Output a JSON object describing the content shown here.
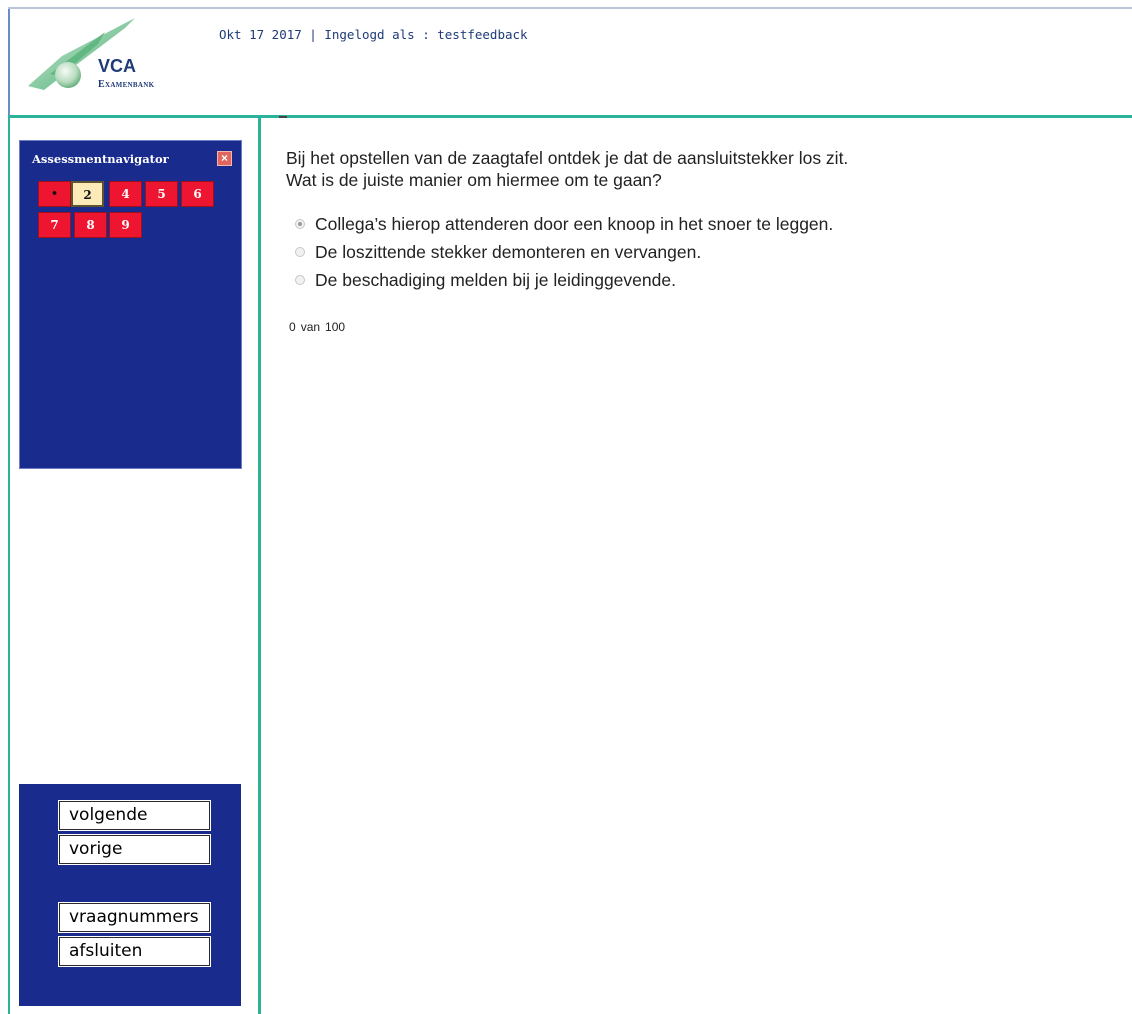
{
  "header": {
    "logo": {
      "line1": "VCA",
      "line2": "Examenbank"
    },
    "info": "Okt 17 2017 | Ingelogd als : testfeedback"
  },
  "navigator": {
    "title": "Assessmentnavigator",
    "close_icon": "close-icon",
    "questions": [
      {
        "label": "•",
        "state": "answered"
      },
      {
        "label": "2",
        "state": "current"
      },
      {
        "label": "4",
        "state": "unanswered"
      },
      {
        "label": "5",
        "state": "unanswered"
      },
      {
        "label": "6",
        "state": "unanswered"
      },
      {
        "label": "7",
        "state": "unanswered"
      },
      {
        "label": "8",
        "state": "unanswered"
      },
      {
        "label": "9",
        "state": "unanswered"
      }
    ]
  },
  "buttons": {
    "next": "volgende",
    "previous": "vorige",
    "question_numbers": "vraagnummers",
    "close": "afsluiten"
  },
  "question": {
    "line1": "Bij het opstellen van de zaagtafel ontdek je dat de aansluitstekker los zit.",
    "line2": "Wat is de juiste manier om hiermee om te gaan?",
    "answers": [
      {
        "text": "Collega’s hierop attenderen door een knoop in het snoer te leggen.",
        "selected": true
      },
      {
        "text": "De loszittende stekker demonteren en vervangen.",
        "selected": false
      },
      {
        "text": "De beschadiging melden bij je leidinggevende.",
        "selected": false
      }
    ]
  },
  "score": {
    "value": "0",
    "of": "van",
    "max": "100"
  },
  "colors": {
    "navy": "#1a2b8e",
    "teal": "#2bb29b",
    "question_red": "#ee1530",
    "current_yellow": "#fcebb8",
    "logo_green": "#3aa86a"
  }
}
